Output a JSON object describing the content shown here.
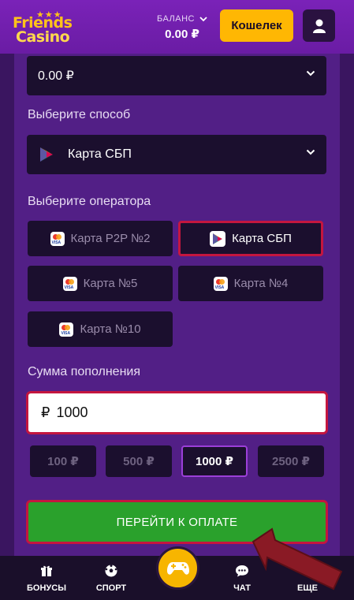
{
  "header": {
    "logo_line1": "Friends",
    "logo_line2": "Casino",
    "balance_label": "БАЛАНС",
    "balance_value": "0.00 ₽",
    "wallet_button": "Кошелек"
  },
  "form": {
    "top_select_value": "0.00 ₽",
    "method_label": "Выберите способ",
    "method_value": "Карта СБП",
    "operator_label": "Выберите оператора",
    "operators": [
      {
        "label": "Карта P2P №2",
        "icon": "card-icon",
        "active": false
      },
      {
        "label": "Карта СБП",
        "icon": "sbp-icon",
        "active": true
      },
      {
        "label": "Карта №5",
        "icon": "card-icon",
        "active": false
      },
      {
        "label": "Карта №4",
        "icon": "card-icon",
        "active": false
      },
      {
        "label": "Карта №10",
        "icon": "card-icon",
        "active": false
      }
    ],
    "amount_label": "Сумма пополнения",
    "amount_currency": "₽",
    "amount_value": "1000",
    "presets": [
      {
        "label": "100 ₽",
        "active": false
      },
      {
        "label": "500 ₽",
        "active": false
      },
      {
        "label": "1000 ₽",
        "active": true
      },
      {
        "label": "2500 ₽",
        "active": false
      }
    ],
    "pay_button": "ПЕРЕЙТИ К ОПЛАТЕ"
  },
  "bottom_nav": {
    "bonuses": "БОНУСЫ",
    "sport": "СПОРТ",
    "chat": "ЧАТ",
    "more": "ЕЩЕ"
  },
  "colors": {
    "accent": "#ffb703",
    "highlight_border": "#c4163f",
    "pay_button": "#2aa12c",
    "panel": "#521f86",
    "field": "#1b0f2e"
  }
}
